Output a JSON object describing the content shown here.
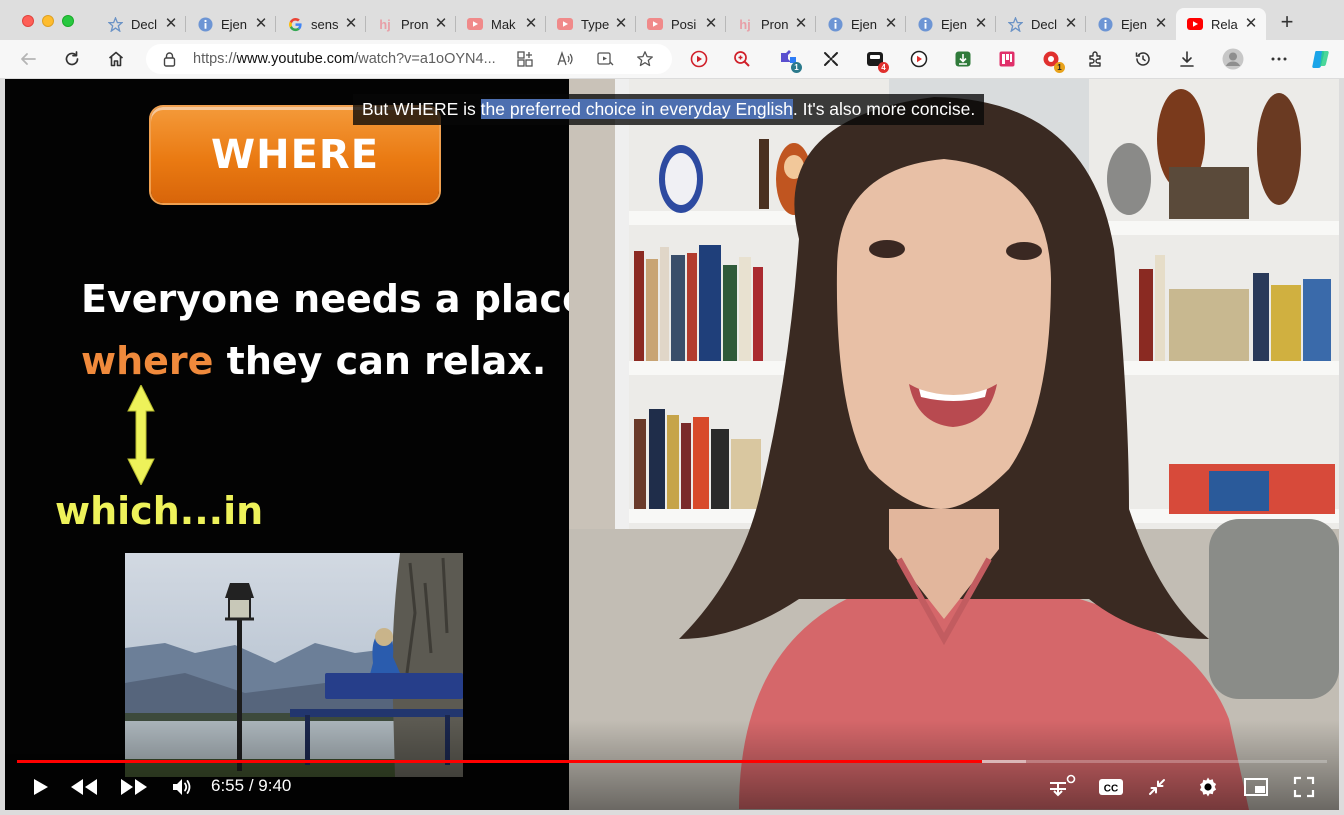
{
  "browser": {
    "tabs": [
      {
        "favicon": "star-icon",
        "label": "Decl",
        "active": false
      },
      {
        "favicon": "info-icon",
        "label": "Ejen",
        "active": false
      },
      {
        "favicon": "google-icon",
        "label": "sens",
        "active": false
      },
      {
        "favicon": "hj-icon",
        "label": "Pron",
        "active": false
      },
      {
        "favicon": "youtube-icon",
        "label": "Mak",
        "active": false
      },
      {
        "favicon": "youtube-icon",
        "label": "Type",
        "active": false
      },
      {
        "favicon": "youtube-icon",
        "label": "Posi",
        "active": false
      },
      {
        "favicon": "hj-icon",
        "label": "Pron",
        "active": false
      },
      {
        "favicon": "info-icon",
        "label": "Ejen",
        "active": false
      },
      {
        "favicon": "info-icon",
        "label": "Ejen",
        "active": false
      },
      {
        "favicon": "star-icon",
        "label": "Decl",
        "active": false
      },
      {
        "favicon": "info-icon",
        "label": "Ejen",
        "active": false
      },
      {
        "favicon": "youtube-icon",
        "label": "Rela",
        "active": true
      }
    ],
    "url_prefix": "https://",
    "url_domain": "www.youtube.com",
    "url_rest": "/watch?v=a1oOYN4...",
    "extension_badges": {
      "ext1": "1",
      "ext2": "4",
      "ext3": "1"
    }
  },
  "video": {
    "caption_before": "But WHERE is ",
    "caption_highlight": "the preferred choice in everyday English",
    "caption_after": ". It's also more concise.",
    "slide": {
      "button_label": "WHERE",
      "sentence_line1": "Everyone needs a place",
      "sentence_where": "where",
      "sentence_line2_rest": " they can relax.",
      "alternative": "which...in"
    },
    "current_time": "6:55",
    "time_separator": " / ",
    "duration": "9:40",
    "progress_fraction": 0.7364,
    "buffered_fraction": 0.77,
    "colors": {
      "progress": "#ff0000",
      "caption_highlight": "#4d6fb0",
      "where_button": "#ea7a12",
      "where_word": "#f08a3c",
      "which_text": "#eef25a"
    }
  }
}
